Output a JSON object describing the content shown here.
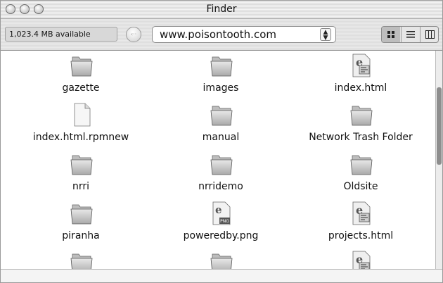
{
  "window": {
    "title": "Finder"
  },
  "toolbar": {
    "available": "1,023.4 MB available",
    "location": "www.poisontooth.com",
    "back_glyph": "‹··",
    "view_icons": [
      "icon-view-icon",
      "list-view-icon",
      "column-view-icon"
    ]
  },
  "items": [
    {
      "label": "gazette",
      "icon": "folder-icon"
    },
    {
      "label": "images",
      "icon": "folder-icon"
    },
    {
      "label": "index.html",
      "icon": "html-document-icon"
    },
    {
      "label": "index.html.rpmnew",
      "icon": "generic-document-icon"
    },
    {
      "label": "manual",
      "icon": "folder-icon"
    },
    {
      "label": "Network Trash Folder",
      "icon": "folder-icon"
    },
    {
      "label": "nrri",
      "icon": "folder-icon"
    },
    {
      "label": "nrridemo",
      "icon": "folder-icon"
    },
    {
      "label": "Oldsite",
      "icon": "folder-icon"
    },
    {
      "label": "piranha",
      "icon": "folder-icon"
    },
    {
      "label": "poweredby.png",
      "icon": "png-image-icon"
    },
    {
      "label": "projects.html",
      "icon": "html-document-icon"
    },
    {
      "label": "",
      "icon": "folder-icon"
    },
    {
      "label": "",
      "icon": "folder-icon"
    },
    {
      "label": "",
      "icon": "html-document-icon"
    }
  ],
  "png_badge": "PNG"
}
